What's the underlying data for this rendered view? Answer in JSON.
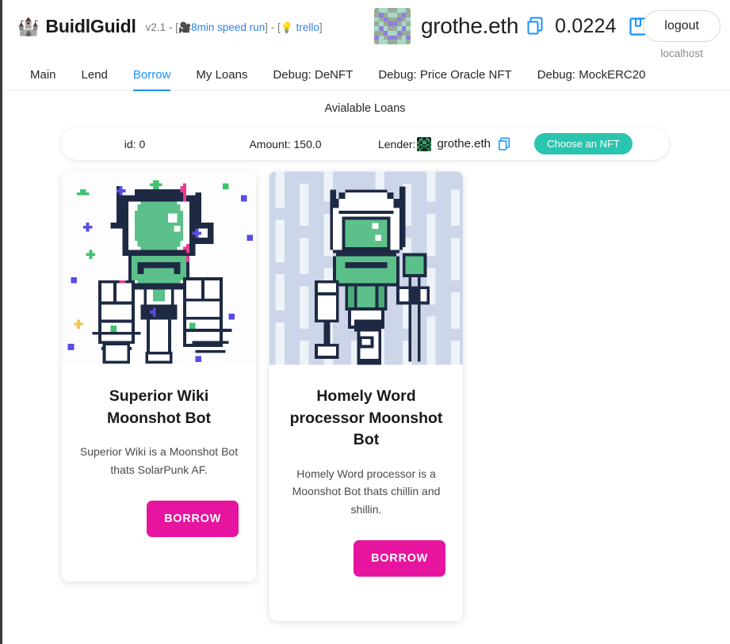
{
  "brand": {
    "logo_icon": "castle-icon",
    "name": "BuidlGuidl",
    "version": "v2.1",
    "sep_open": " - [",
    "video_icon": "movie-camera-icon",
    "speed_run_link": "8min speed run",
    "sep_mid": "] - [",
    "bulb_icon": "light-bulb-icon",
    "trello_link": "trello",
    "sep_close": "]"
  },
  "account": {
    "avatar_icon": "blockie-avatar",
    "name": "grothe.eth",
    "copy_icon": "copy-icon",
    "balance": "0.0224",
    "save_icon": "save-icon",
    "logout_label": "logout",
    "network": "localhost"
  },
  "nav": {
    "tabs": [
      {
        "label": "Main",
        "active": false
      },
      {
        "label": "Lend",
        "active": false
      },
      {
        "label": "Borrow",
        "active": true
      },
      {
        "label": "My Loans",
        "active": false
      },
      {
        "label": "Debug: DeNFT",
        "active": false
      },
      {
        "label": "Debug: Price Oracle NFT",
        "active": false
      },
      {
        "label": "Debug: MockERC20",
        "active": false
      }
    ]
  },
  "main": {
    "section_title": "Avialable Loans",
    "loan": {
      "id": "id: 0",
      "amount": "Amount: 150.0",
      "lender_label": "Lender:",
      "lender_avatar_icon": "blockie-avatar",
      "lender_name": "grothe.eth",
      "copy_icon": "copy-icon",
      "action_label": "Choose an NFT"
    },
    "cards": [
      {
        "art_icon": "pixel-robot-solarpunk",
        "title": "Superior Wiki Moonshot Bot",
        "description": "Superior Wiki is a Moonshot Bot thats SolarPunk AF.",
        "button_label": "BORROW"
      },
      {
        "art_icon": "pixel-robot-word-processor",
        "title": "Homely Word processor Moonshot Bot",
        "description": "Homely Word processor is a Moonshot Bot thats chillin and shillin.",
        "button_label": "BORROW"
      }
    ]
  },
  "colors": {
    "accent_blue": "#1890ff",
    "link_blue": "#2f80ed",
    "teal_pill": "#2bc4b0",
    "magenta_button": "#e6149e",
    "art_green": "#5cc08a",
    "art_navy": "#1e2a44",
    "card2_bg": "#dde4f0"
  }
}
